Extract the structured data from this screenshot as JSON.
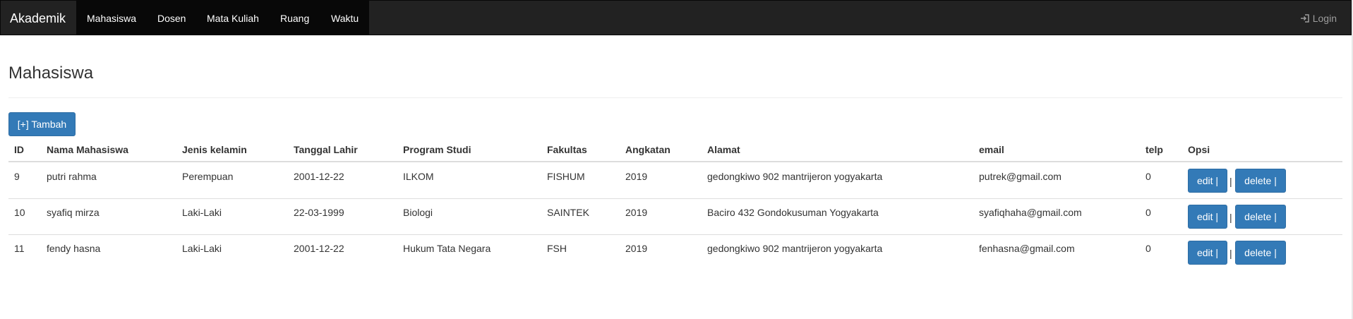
{
  "navbar": {
    "brand": "Akademik",
    "items": [
      "Mahasiswa",
      "Dosen",
      "Mata Kuliah",
      "Ruang",
      "Waktu"
    ],
    "login_label": "Login"
  },
  "page": {
    "title": "Mahasiswa",
    "add_button": "[+] Tambah"
  },
  "table": {
    "headers": [
      "ID",
      "Nama Mahasiswa",
      "Jenis kelamin",
      "Tanggal Lahir",
      "Program Studi",
      "Fakultas",
      "Angkatan",
      "Alamat",
      "email",
      "telp",
      "Opsi"
    ],
    "rows": [
      [
        "9",
        "putri rahma",
        "Perempuan",
        "2001-12-22",
        "ILKOM",
        "FISHUM",
        "2019",
        "gedongkiwo 902 mantrijeron yogyakarta",
        "putrek@gmail.com",
        "0"
      ],
      [
        "10",
        "syafiq mirza",
        "Laki-Laki",
        "22-03-1999",
        "Biologi",
        "SAINTEK",
        "2019",
        "Baciro 432 Gondokusuman Yogyakarta",
        "syafiqhaha@gmail.com",
        "0"
      ],
      [
        "11",
        "fendy hasna",
        "Laki-Laki",
        "2001-12-22",
        "Hukum Tata Negara",
        "FSH",
        "2019",
        "gedongkiwo 902 mantrijeron yogyakarta",
        "fenhasna@gmail.com",
        "0"
      ]
    ],
    "edit_label": "edit |",
    "delete_label": "delete |",
    "separator": "|"
  },
  "colors": {
    "navbar_bg": "#222222",
    "primary": "#337ab7"
  },
  "icons": {
    "login": "sign-in-icon"
  }
}
